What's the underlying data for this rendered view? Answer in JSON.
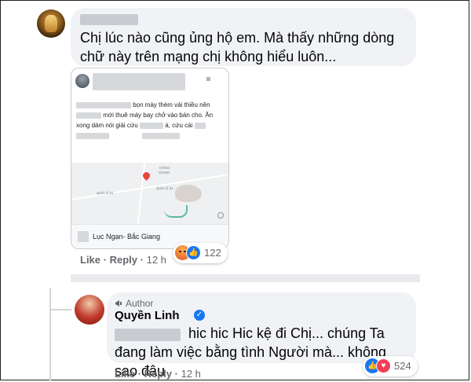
{
  "comment1": {
    "text": "Chị lúc nào cũng ủng hộ em. Mà thấy những dòng chữ này trên mạng chị không hiểu luôn...",
    "shared_post": {
      "line1": "bọn mày thèm vải thiều nên",
      "line2": "mới thuê máy bay chở vào bán cho. Ăn",
      "line3_a": "xong dám nói giải cứu",
      "line3_b": "à, cứu cái",
      "map_labels": {
        "hong": "HỒNG",
        "giang": "GIANG",
        "road1": "Quốc lộ 31",
        "road2": "Quốc lộ 31"
      },
      "location": "Lục Ngạn- Bắc Giang"
    },
    "actions": {
      "like": "Like",
      "reply": "Reply",
      "time": "12 h",
      "sep": "·"
    },
    "reactions": {
      "icons": [
        "angry-icon",
        "like-icon"
      ],
      "count": "122",
      "like_glyph": "👍"
    }
  },
  "reply": {
    "author_badge": "Author",
    "name": "Quyền Linh",
    "verified_glyph": "✓",
    "text": "hic hic Hic kệ đi Chị... chúng Ta đang làm việc bằng tình Người mà... không sao đâu",
    "actions": {
      "like": "Like",
      "reply": "Reply",
      "time": "12 h",
      "sep": "·"
    },
    "reactions": {
      "icons": [
        "like-icon",
        "heart-icon"
      ],
      "count": "524",
      "like_glyph": "👍",
      "heart_glyph": "♥"
    }
  },
  "colors": {
    "bubble": "#f0f2f5",
    "muted": "#65676b",
    "fb_blue": "#1877f2",
    "heart": "#f33e58"
  }
}
